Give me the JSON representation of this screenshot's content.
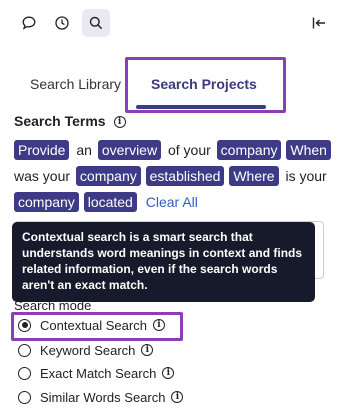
{
  "toolbar": {
    "icons": [
      "chat-icon",
      "history-icon",
      "search-icon",
      "collapse-right-icon"
    ],
    "active": "search-icon"
  },
  "tabs": [
    {
      "label": "Search Library",
      "active": false
    },
    {
      "label": "Search Projects",
      "active": true
    }
  ],
  "search_terms": {
    "heading": "Search Terms",
    "tokens": [
      {
        "text": "Provide",
        "chip": true
      },
      {
        "text": "an",
        "chip": false
      },
      {
        "text": "overview",
        "chip": true
      },
      {
        "text": "of your",
        "chip": false
      },
      {
        "text": "company",
        "chip": true
      },
      {
        "text": "When",
        "chip": true
      },
      {
        "text": "was your",
        "chip": false
      },
      {
        "text": "company",
        "chip": true
      },
      {
        "text": "established",
        "chip": true
      },
      {
        "text": "Where",
        "chip": true
      },
      {
        "text": "is your",
        "chip": false
      },
      {
        "text": "company",
        "chip": true
      },
      {
        "text": "located",
        "chip": true
      }
    ],
    "clear_all": "Clear All"
  },
  "tooltip": {
    "text": "Contextual search is a smart search that understands word meanings in context and finds related information, even if the search words aren't an exact match."
  },
  "search_mode": {
    "label": "Search mode",
    "options": [
      {
        "label": "Contextual Search",
        "selected": true
      },
      {
        "label": "Keyword Search",
        "selected": false
      },
      {
        "label": "Exact Match Search",
        "selected": false
      },
      {
        "label": "Similar Words Search",
        "selected": false
      }
    ]
  },
  "colors": {
    "accent": "#3d3b86",
    "highlight": "#8a3fb8",
    "tooltip_bg": "#171a2b",
    "link": "#2f5fc4"
  }
}
